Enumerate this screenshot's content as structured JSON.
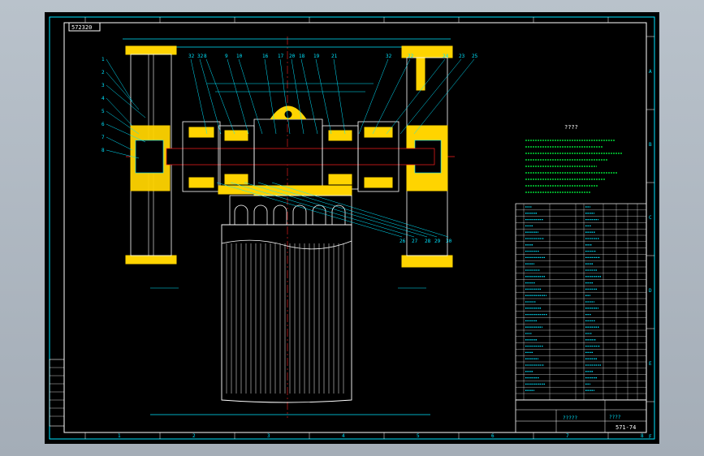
{
  "drawing": {
    "stamp": "572320",
    "tech_title": "????",
    "border_letters": [
      "A",
      "B",
      "C",
      "D",
      "E",
      "F"
    ],
    "border_numbers": [
      "1",
      "2",
      "3",
      "4",
      "5",
      "6",
      "7",
      "8"
    ],
    "title_block": {
      "name": "?????",
      "scale_info": "????",
      "drawing_no": "571-74"
    },
    "part_labels": [
      "32",
      "32",
      "8",
      "9",
      "10",
      "16",
      "17",
      "20",
      "18",
      "19",
      "21",
      "32",
      "22",
      "24",
      "23",
      "25",
      "26",
      "27",
      "28",
      "29",
      "30"
    ],
    "left_labels": [
      "1",
      "2",
      "3",
      "4",
      "5",
      "6",
      "7",
      "8"
    ]
  },
  "colors": {
    "line": "#00e5ff",
    "part": "#ffd400",
    "center": "#ff2020",
    "outline": "#ffffff",
    "note": "#00ff40"
  }
}
